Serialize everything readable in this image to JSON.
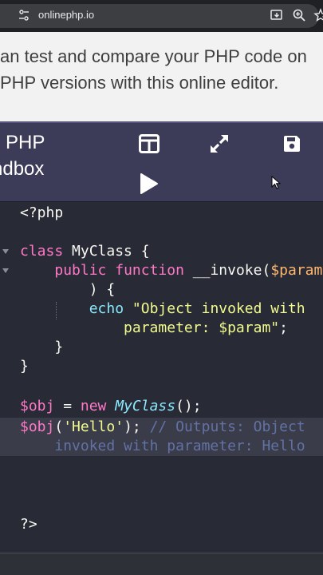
{
  "browser": {
    "url": "onlinephp.io"
  },
  "intro": {
    "line1": "an test and compare your PHP code on",
    "line2": "PHP versions with this online editor."
  },
  "toolbar": {
    "brand_line1": "PHP",
    "brand_line2": "ndbox",
    "buttons": [
      "split-view",
      "fullscreen",
      "save",
      "run"
    ]
  },
  "editor": {
    "open_tag": "<?php",
    "class_keyword": "class",
    "class_name": "MyClass",
    "open_brace": " {",
    "public_kw": "public",
    "function_kw": "function",
    "method_name": "__invoke(",
    "param_name": "$param",
    "method_close": ") {",
    "echo_kw": "echo",
    "string_part1": "\"Object invoked with",
    "string_part2": "parameter: $param\"",
    "semicolon": ";",
    "inner_close": "}",
    "outer_close": "}",
    "obj_var": "$obj",
    "assign": " = ",
    "new_kw": "new",
    "new_class": "MyClass",
    "ctor_call": "();",
    "call_var": "$obj",
    "call_open": "(",
    "call_arg": "'Hello'",
    "call_close": ");",
    "comment_part1": "// Outputs: Object",
    "comment_part2": "invoked with parameter: Hello",
    "close_tag": "?>"
  }
}
